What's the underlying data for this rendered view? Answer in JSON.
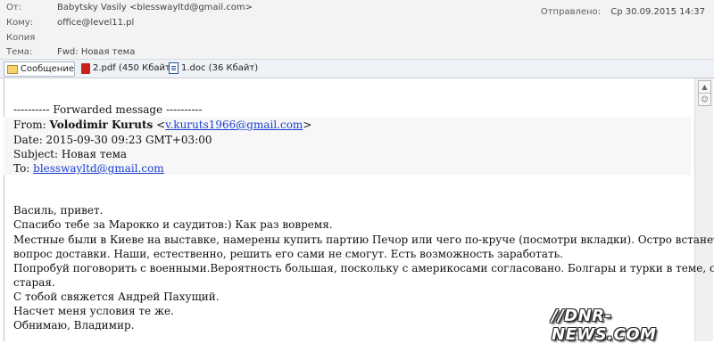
{
  "header": {
    "from_label": "От:",
    "from_value": "Babytsky Vasily <blesswayltd@gmail.com>",
    "to_label": "Кому:",
    "to_value": "office@level11.pl",
    "cc_label": "Копия",
    "cc_value": "",
    "subject_label": "Тема:",
    "subject_value": "Fwd: Новая тема",
    "sent_label": "Отправлено:",
    "sent_value": "Ср 30.09.2015 14:37"
  },
  "attachments": {
    "message_tab": "Сообщение",
    "files": [
      {
        "name": "2.pdf (450 Кбайт)",
        "icon": "pdf-icon"
      },
      {
        "name": "1.doc (36 Кбайт)",
        "icon": "doc-icon"
      }
    ]
  },
  "body": {
    "forward_header": "---------- Forwarded message ----------",
    "from_prefix": "From: ",
    "from_name": "Volodimir Kuruts",
    "from_email": "v.kuruts1966@gmail.com",
    "date": "Date: 2015-09-30 09:23 GMT+03:00",
    "subject": "Subject: Новая тема",
    "to_prefix": "To: ",
    "to_email": "blesswayltd@gmail.com",
    "lines": [
      "Василь, привет.",
      "Спасибо тебе за Марокко и саудитов:) Как раз вовремя.",
      "Местные были в Киеве на выставке, намерены купить партию Печор или чего по-круче (посмотри вкладки). Остро встанет",
      "вопрос доставки. Наши, естественно, решить его сами не смогут. Есть возможность заработать.",
      "Попробуй поговорить с военными.Вероятность большая, поскольку с америкосами согласовано. Болгары и турки в теме, схема",
      "старая.",
      "С тобой свяжется Андрей Пахущий.",
      "Насчет меня условия те же.",
      "Обнимаю, Владимир."
    ]
  },
  "watermark": "//DNR-NEWS.COM"
}
